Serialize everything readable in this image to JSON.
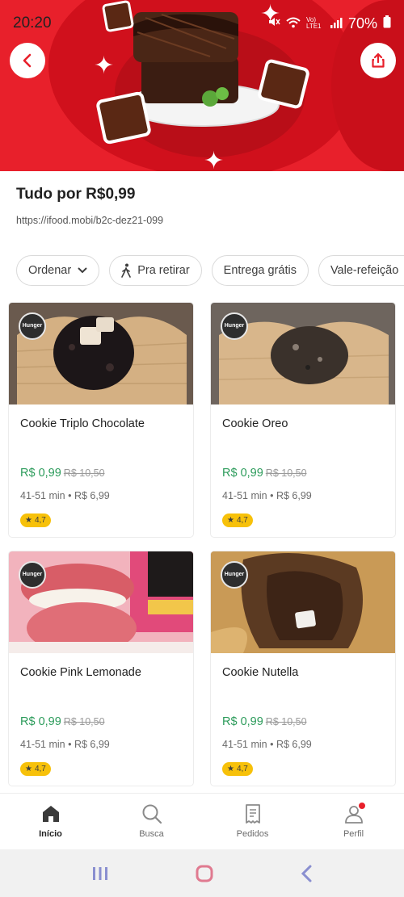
{
  "status_bar": {
    "time": "20:20",
    "battery": "70%",
    "network": "Vo) LTE1"
  },
  "header": {
    "back_icon": "chevron-left-icon",
    "share_icon": "share-icon",
    "title": "Tudo por R$0,99",
    "link": "https://ifood.mobi/b2c-dez21-099"
  },
  "filters": [
    {
      "label": "Ordenar",
      "icon": "chevron-down-icon"
    },
    {
      "label": "Pra retirar",
      "icon": "walking-icon"
    },
    {
      "label": "Entrega grátis"
    },
    {
      "label": "Vale-refeição",
      "icon": "chevron-down-icon"
    }
  ],
  "products": [
    {
      "name": "Cookie Triplo Chocolate",
      "price": "R$ 0,99",
      "old_price": "R$ 10,50",
      "time": "41-51 min",
      "delivery": "R$ 6,99",
      "rating": "4,7",
      "badge": "Hunger"
    },
    {
      "name": "Cookie Oreo",
      "price": "R$ 0,99",
      "old_price": "R$ 10,50",
      "time": "41-51 min",
      "delivery": "R$ 6,99",
      "rating": "4,7",
      "badge": "Hunger"
    },
    {
      "name": "Cookie Pink Lemonade",
      "price": "R$ 0,99",
      "old_price": "R$ 10,50",
      "time": "41-51 min",
      "delivery": "R$ 6,99",
      "rating": "4,7",
      "badge": "Hunger"
    },
    {
      "name": "Cookie Nutella",
      "price": "R$ 0,99",
      "old_price": "R$ 10,50",
      "time": "41-51 min",
      "delivery": "R$ 6,99",
      "rating": "4,7",
      "badge": "Hunger"
    }
  ],
  "bottom_nav": [
    {
      "label": "Início",
      "icon": "home-icon",
      "active": true
    },
    {
      "label": "Busca",
      "icon": "search-icon"
    },
    {
      "label": "Pedidos",
      "icon": "receipt-icon"
    },
    {
      "label": "Perfil",
      "icon": "profile-icon"
    }
  ],
  "separator": "•",
  "colors": {
    "brand_red": "#e8202b",
    "price_green": "#2b9b5a",
    "rating_yellow": "#f7c10a"
  }
}
